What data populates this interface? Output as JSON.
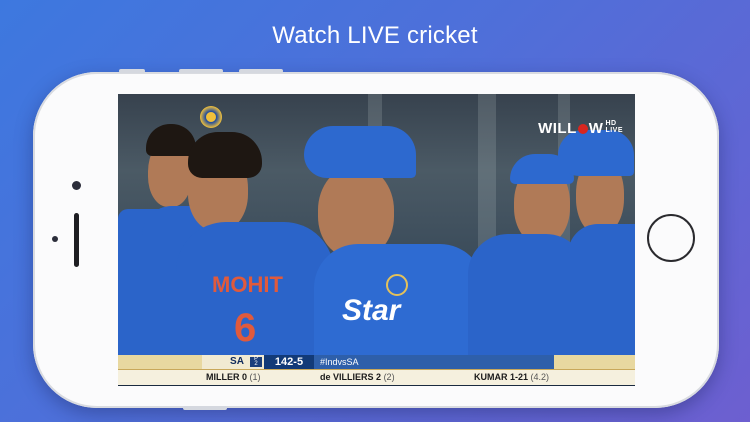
{
  "headline": "Watch LIVE cricket",
  "video": {
    "broadcaster": {
      "logo_text_1": "WILL",
      "logo_text_2": "W",
      "badge_top": "HD",
      "badge_bottom": "LIVE"
    },
    "jersey_name": "MOHIT",
    "jersey_number": "6",
    "sponsor_text": "Star",
    "scoreboard": {
      "batting_team": "SA",
      "powerplay_label": "P",
      "powerplay_number": "2",
      "score": "142-5",
      "hashtag": "#IndvsSA",
      "batsman_1_name": "MILLER",
      "batsman_1_runs": "0",
      "batsman_1_balls": "(1)",
      "batsman_2_name": "de VILLIERS",
      "batsman_2_runs": "2",
      "batsman_2_balls": "(2)",
      "bowler_name": "KUMAR",
      "bowler_figures": "1-21",
      "bowler_overs": "(4.2)"
    }
  },
  "colors": {
    "background_start": "#3d78df",
    "background_end": "#6d5fd0",
    "jersey_blue": "#2b64c9",
    "scoreboard_navy": "#123a78",
    "scoreboard_gold": "#e8d8a0"
  }
}
